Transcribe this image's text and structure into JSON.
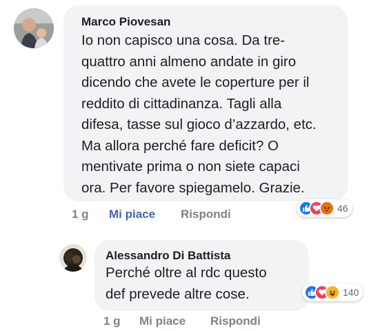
{
  "comments": [
    {
      "author": "Marco Piovesan",
      "lines": [
        "Io non capisco una cosa. Da tre-",
        "quattro anni almeno andate in giro",
        "dicendo che avete le coperture per il",
        "reddito di cittadinanza. Tagli alla",
        "difesa, tasse sul gioco d’azzardo, etc.",
        "Ma allora perché fare deficit? O",
        "mentivate prima o non siete capaci",
        "ora. Per favore spiegamelo. Grazie."
      ],
      "time": "1 g",
      "like_label": "Mi piace",
      "reply_label": "Rispondi",
      "reaction_icons": [
        "like-reaction-icon",
        "love-reaction-icon",
        "angry-reaction-icon"
      ],
      "reaction_count": "46"
    },
    {
      "author": "Alessandro Di Battista",
      "lines": [
        "Perché oltre al rdc questo",
        "def prevede altre cose."
      ],
      "time": "1 g",
      "like_label": "Mi piace",
      "reply_label": "Rispondi",
      "reaction_icons": [
        "like-reaction-icon",
        "love-reaction-icon",
        "haha-reaction-icon"
      ],
      "reaction_count": "140"
    }
  ],
  "colors": {
    "bubble": "#f2f3f5",
    "liked_link": "#4267b2",
    "meta": "#7f8289",
    "like": "#1877f2",
    "love": "#f33e58",
    "angry": "#e9710f",
    "haha": "#f7b125"
  }
}
